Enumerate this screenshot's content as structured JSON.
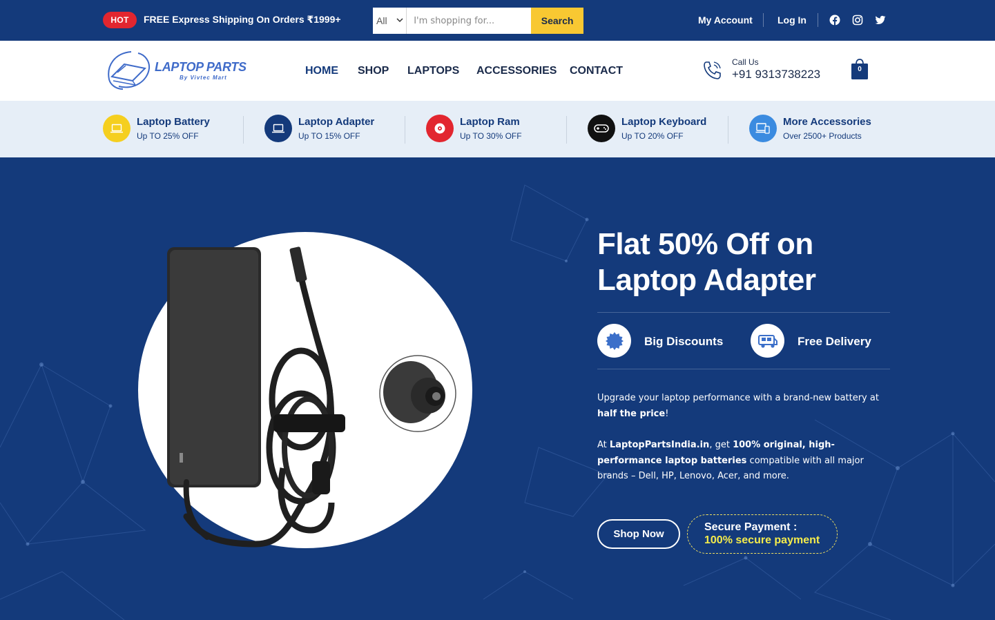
{
  "topbar": {
    "badge": "HOT",
    "promo": "FREE Express Shipping On Orders ₹1999+",
    "search": {
      "category": "All",
      "placeholder": "I'm shopping for...",
      "button": "Search"
    },
    "links": [
      "My Account",
      "Log In"
    ],
    "social": [
      "facebook-icon",
      "instagram-icon",
      "twitter-icon"
    ]
  },
  "header": {
    "logo_text": "LAPTOP PARTS",
    "logo_sub": "By Vivtec Mart",
    "nav": [
      "HOME",
      "SHOP",
      "LAPTOPS",
      "ACCESSORIES",
      "CONTACT"
    ],
    "call_label": "Call Us",
    "call_number": "+91 9313738223",
    "cart_count": "0"
  },
  "categories": [
    {
      "title": "Laptop Battery",
      "sub": "Up TO 25% OFF",
      "color": "#f5cf1f",
      "icon": "laptop-icon"
    },
    {
      "title": "Laptop Adapter",
      "sub": "Up TO 15% OFF",
      "color": "#143a7b",
      "icon": "laptop-icon"
    },
    {
      "title": "Laptop Ram",
      "sub": "Up TO 30% OFF",
      "color": "#e2262f",
      "icon": "disc-icon"
    },
    {
      "title": "Laptop Keyboard",
      "sub": "Up TO 20% OFF",
      "color": "#111111",
      "icon": "gamepad-icon"
    },
    {
      "title": "More Accessories",
      "sub": "Over 2500+ Products",
      "color": "#3b8be0",
      "icon": "devices-icon"
    }
  ],
  "hero": {
    "title_line1": "Flat 50% Off on",
    "title_line2": "Laptop Adapter",
    "features": [
      "Big Discounts",
      "Free Delivery"
    ],
    "desc1_a": "Upgrade your laptop performance with a brand-new battery at ",
    "desc1_b": "half the price",
    "desc1_c": "!",
    "desc2_a": "At ",
    "desc2_b": "LaptopPartsIndia.in",
    "desc2_c": ", get ",
    "desc2_d": "100% original, high-performance laptop batteries",
    "desc2_e": " compatible with all major brands – Dell, HP, Lenovo, Acer, and more.",
    "shop_button": "Shop Now",
    "secure_title": "Secure Payment :",
    "secure_sub": "100% secure payment"
  },
  "colors": {
    "primary": "#143a7b",
    "accent": "#f8c832",
    "hot": "#e2262f",
    "secure_highlight": "#f5ec4b"
  }
}
